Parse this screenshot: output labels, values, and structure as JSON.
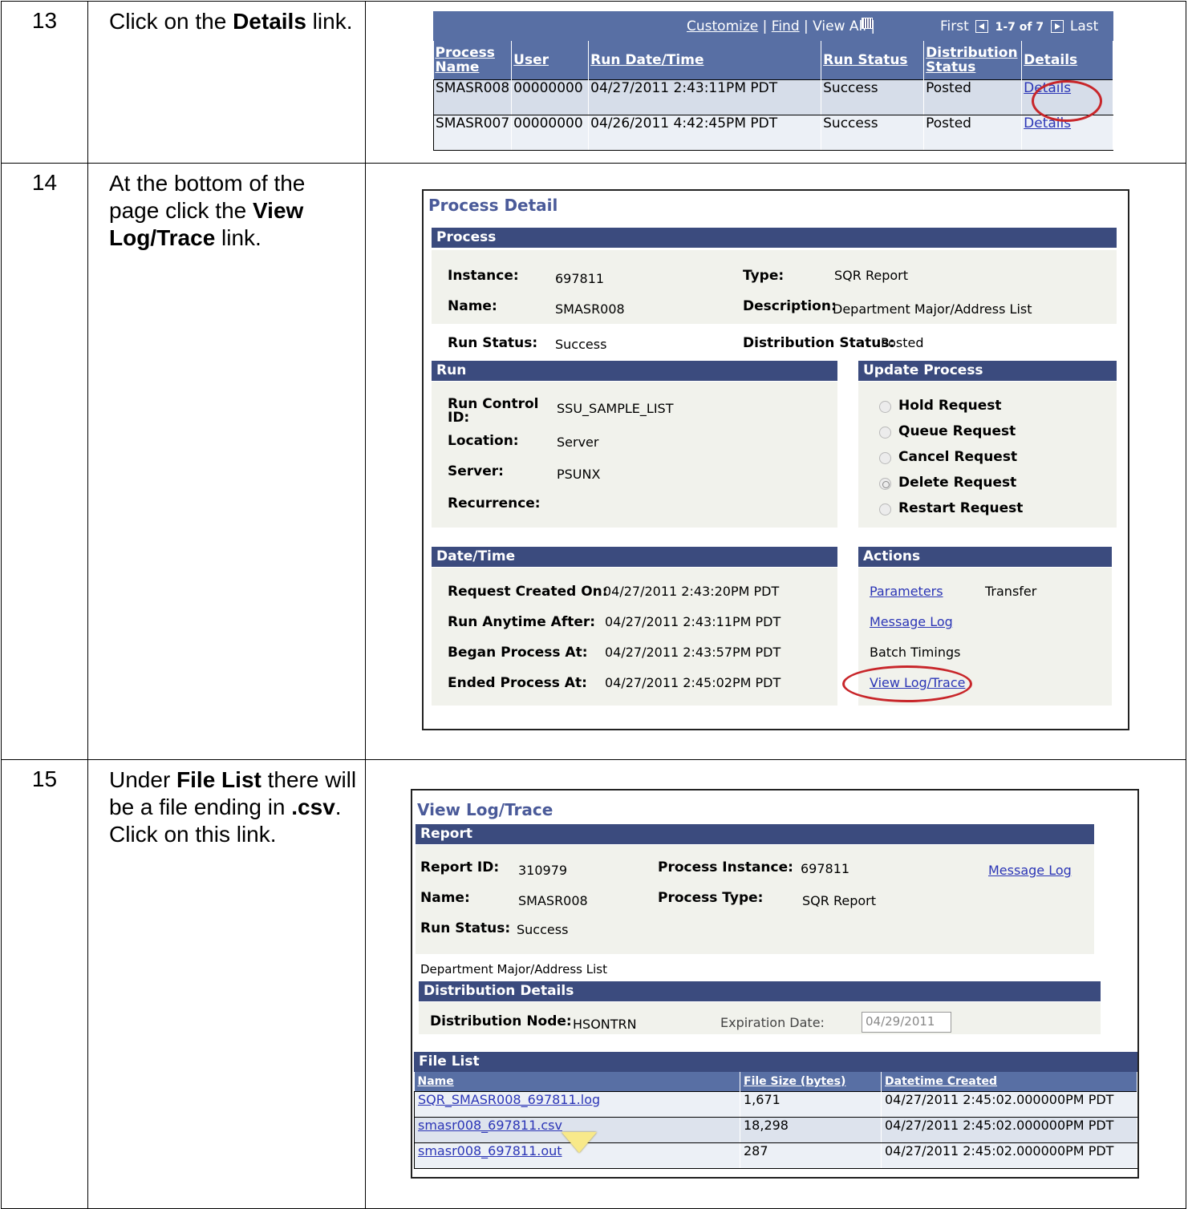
{
  "steps": [
    {
      "num": "13",
      "text_pre": "Click on the ",
      "bold": "Details",
      "text_post": " link."
    },
    {
      "num": "14",
      "text_pre": "At the bottom of the page click the ",
      "bold": "View Log/Trace",
      "text_post": " link."
    },
    {
      "num": "15",
      "text_pre": "Under ",
      "bold": "File List",
      "text_mid": " there will be a file ending in ",
      "bold2": ".csv",
      "text_post": ". Click on this link."
    }
  ],
  "grid": {
    "nav": {
      "customize": "Customize",
      "sep1": " | ",
      "find": "Find",
      "sep2": " | View All | ",
      "first": "First",
      "range": "1-7 of 7",
      "last": "Last"
    },
    "headers": [
      "Process Name",
      "User",
      "Run Date/Time",
      "Run Status",
      "Distribution Status",
      "Details"
    ],
    "rows": [
      [
        "SMASR008",
        "00000000",
        "04/27/2011  2:43:11PM PDT",
        "Success",
        "Posted",
        "Details"
      ],
      [
        "SMASR007",
        "00000000",
        "04/26/2011  4:42:45PM PDT",
        "Success",
        "Posted",
        "Details"
      ]
    ]
  },
  "process_detail": {
    "title": "Process Detail",
    "process_bar": "Process",
    "instance_label": "Instance:",
    "instance": "697811",
    "type_label": "Type:",
    "type": "SQR Report",
    "name_label": "Name:",
    "name": "SMASR008",
    "desc_label": "Description:",
    "desc": "Department Major/Address List",
    "run_status_label": "Run Status:",
    "run_status": "Success",
    "dist_status_label": "Distribution Status:",
    "dist_status": "Posted",
    "run_bar": "Run",
    "run_control_label": "Run Control ID:",
    "run_control": "SSU_SAMPLE_LIST",
    "location_label": "Location:",
    "location": "Server",
    "server_label": "Server:",
    "server": "PSUNX",
    "recurrence_label": "Recurrence:",
    "update_bar": "Update Process",
    "update_options": [
      "Hold Request",
      "Queue Request",
      "Cancel Request",
      "Delete Request",
      "Restart Request"
    ],
    "datetime_bar": "Date/Time",
    "created_label": "Request Created On:",
    "created": "04/27/2011  2:43:20PM PDT",
    "anytime_label": "Run Anytime After:",
    "anytime": "04/27/2011  2:43:11PM PDT",
    "began_label": "Began Process At:",
    "began": "04/27/2011  2:43:57PM PDT",
    "ended_label": "Ended Process At:",
    "ended": "04/27/2011  2:45:02PM PDT",
    "actions_bar": "Actions",
    "parameters": "Parameters",
    "transfer": "Transfer",
    "message_log": "Message Log",
    "batch_timings": "Batch Timings",
    "view_log": "View Log/Trace"
  },
  "view_log": {
    "title": "View Log/Trace",
    "report_bar": "Report",
    "report_id_label": "Report ID:",
    "report_id": "310979",
    "instance_label": "Process Instance:",
    "instance": "697811",
    "message_log": "Message Log",
    "name_label": "Name:",
    "name": "SMASR008",
    "ptype_label": "Process Type:",
    "ptype": "SQR Report",
    "run_status_label": "Run Status:",
    "run_status": "Success",
    "description": "Department Major/Address List",
    "dist_bar": "Distribution Details",
    "node_label": "Distribution Node:",
    "node": "HSONTRN",
    "exp_label": "Expiration Date:",
    "exp": "04/29/2011",
    "file_bar": "File List",
    "file_headers": [
      "Name",
      "File Size (bytes)",
      "Datetime Created"
    ],
    "files": [
      [
        "SQR_SMASR008_697811.log",
        "1,671",
        "04/27/2011  2:45:02.000000PM PDT"
      ],
      [
        "smasr008_697811.csv",
        "18,298",
        "04/27/2011  2:45:02.000000PM PDT"
      ],
      [
        "smasr008_697811.out",
        "287",
        "04/27/2011  2:45:02.000000PM PDT"
      ]
    ]
  }
}
